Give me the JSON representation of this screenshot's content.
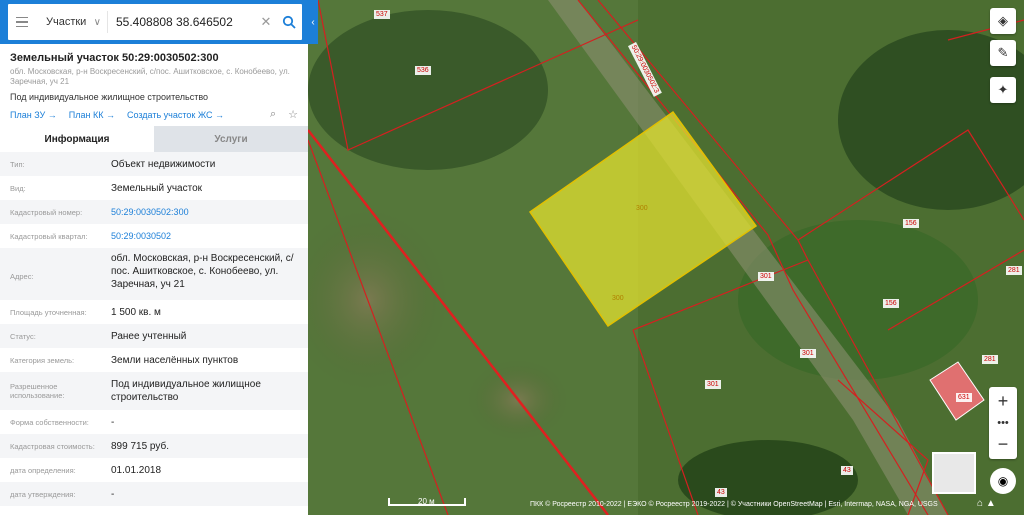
{
  "search": {
    "layer": "Участки",
    "query": "55.408808 38.646502"
  },
  "parcel": {
    "title": "Земельный участок 50:29:0030502:300",
    "address_line": "обл. Московская, р-н Воскресенский, с/пос. Ашитковское, с. Конобеево, ул. Заречная, уч 21",
    "usage": "Под индивидуальное жилищное строительство",
    "links": [
      "План ЗУ",
      "План КК",
      "Создать участок ЖС"
    ]
  },
  "tabs": [
    "Информация",
    "Услуги"
  ],
  "rows": [
    {
      "k": "Тип:",
      "v": "Объект недвижимости"
    },
    {
      "k": "Вид:",
      "v": "Земельный участок"
    },
    {
      "k": "Кадастровый номер:",
      "v": "50:29:0030502:300"
    },
    {
      "k": "Кадастровый квартал:",
      "v": "50:29:0030502"
    },
    {
      "k": "Адрес:",
      "v": "обл. Московская, р-н Воскресенский, с/пос. Ашитковское, с. Конобеево, ул. Заречная, уч 21"
    },
    {
      "k": "Площадь уточненная:",
      "v": "1 500 кв. м"
    },
    {
      "k": "Статус:",
      "v": "Ранее учтенный"
    },
    {
      "k": "Категория земель:",
      "v": "Земли населённых пунктов"
    },
    {
      "k": "Разрешенное использование:",
      "v": "Под индивидуальное жилищное строительство"
    },
    {
      "k": "Форма собственности:",
      "v": "-"
    },
    {
      "k": "Кадастровая стоимость:",
      "v": "899 715 руб."
    },
    {
      "k": "дата определения:",
      "v": "01.01.2018"
    },
    {
      "k": "дата утверждения:",
      "v": "-"
    }
  ],
  "map": {
    "labels": [
      "537",
      "536",
      "300",
      "300",
      "301",
      "301",
      "301",
      "156",
      "156",
      "281",
      "281",
      "631",
      "43",
      "43"
    ],
    "road_label": "50:29:0030502:3",
    "scale": "20 м",
    "attribution": "ПКК © Росреестр 2010-2022 | ЕЭКО © Росреестр 2019-2022 | © Участники OpenStreetMap | Esri, Intermap, NASA, NGA, USGS"
  },
  "icons": [
    "menu-icon",
    "chevron-down-icon",
    "clear-icon",
    "search-icon",
    "layers-icon",
    "ruler-icon",
    "target-icon",
    "zoom-in-icon",
    "zoom-out-icon",
    "compass-icon",
    "star-icon"
  ],
  "colors": {
    "accent": "#1c7fd8",
    "parcel_fill": "#e2e030",
    "boundary": "#d42020"
  }
}
